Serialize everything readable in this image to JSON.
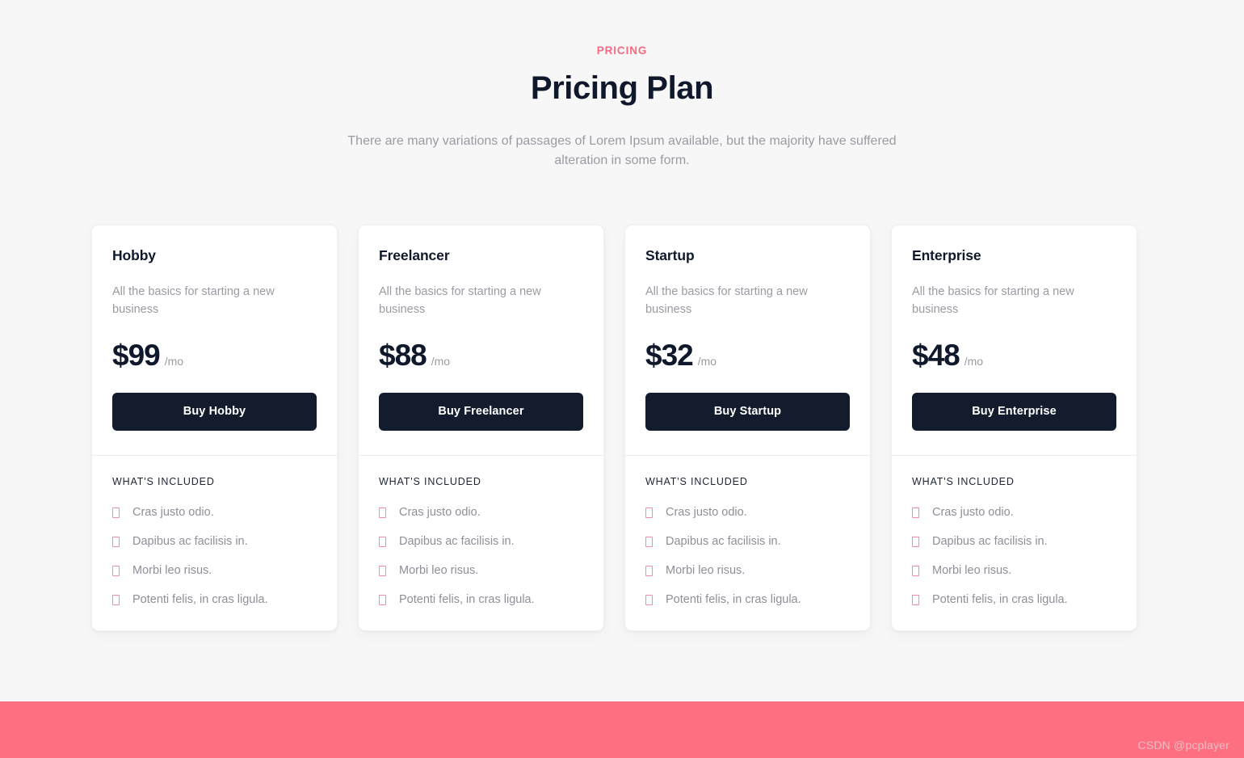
{
  "header": {
    "eyebrow": "PRICING",
    "title": "Pricing Plan",
    "subtitle": "There are many variations of passages of Lorem Ipsum available, but the majority have suffered alteration in some form."
  },
  "colors": {
    "page_background": "#f7f7f8",
    "accent_pink": "#f76a82",
    "footer_band": "#fd6f81",
    "button_dark": "#121c2d",
    "card_background": "#ffffff",
    "heading_dark": "#10182b",
    "muted_text": "#9a9ba3",
    "marker_pink": "#f58ba0"
  },
  "plans": [
    {
      "name": "Hobby",
      "description": "All the basics for starting a new business",
      "price": "$99",
      "period": "/mo",
      "button_label": "Buy Hobby",
      "included_title": "WHAT'S INCLUDED",
      "features": [
        "Cras justo odio.",
        "Dapibus ac facilisis in.",
        "Morbi leo risus.",
        "Potenti felis, in cras ligula."
      ]
    },
    {
      "name": "Freelancer",
      "description": "All the basics for starting a new business",
      "price": "$88",
      "period": "/mo",
      "button_label": "Buy Freelancer",
      "included_title": "WHAT'S INCLUDED",
      "features": [
        "Cras justo odio.",
        "Dapibus ac facilisis in.",
        "Morbi leo risus.",
        "Potenti felis, in cras ligula."
      ]
    },
    {
      "name": "Startup",
      "description": "All the basics for starting a new business",
      "price": "$32",
      "period": "/mo",
      "button_label": "Buy Startup",
      "included_title": "WHAT'S INCLUDED",
      "features": [
        "Cras justo odio.",
        "Dapibus ac facilisis in.",
        "Morbi leo risus.",
        "Potenti felis, in cras ligula."
      ]
    },
    {
      "name": "Enterprise",
      "description": "All the basics for starting a new business",
      "price": "$48",
      "period": "/mo",
      "button_label": "Buy Enterprise",
      "included_title": "WHAT'S INCLUDED",
      "features": [
        "Cras justo odio.",
        "Dapibus ac facilisis in.",
        "Morbi leo risus.",
        "Potenti felis, in cras ligula."
      ]
    }
  ],
  "footer": {
    "watermark": "CSDN @pcplayer"
  }
}
